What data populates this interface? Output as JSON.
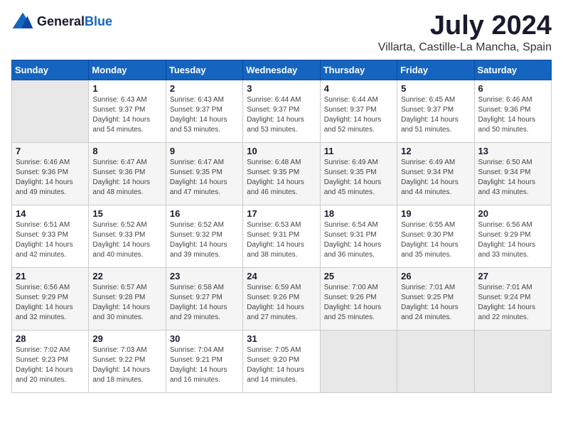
{
  "logo": {
    "general": "General",
    "blue": "Blue"
  },
  "title": "July 2024",
  "location": "Villarta, Castille-La Mancha, Spain",
  "header_days": [
    "Sunday",
    "Monday",
    "Tuesday",
    "Wednesday",
    "Thursday",
    "Friday",
    "Saturday"
  ],
  "weeks": [
    [
      {
        "num": "",
        "sunrise": "",
        "sunset": "",
        "daylight": ""
      },
      {
        "num": "1",
        "sunrise": "Sunrise: 6:43 AM",
        "sunset": "Sunset: 9:37 PM",
        "daylight": "Daylight: 14 hours and 54 minutes."
      },
      {
        "num": "2",
        "sunrise": "Sunrise: 6:43 AM",
        "sunset": "Sunset: 9:37 PM",
        "daylight": "Daylight: 14 hours and 53 minutes."
      },
      {
        "num": "3",
        "sunrise": "Sunrise: 6:44 AM",
        "sunset": "Sunset: 9:37 PM",
        "daylight": "Daylight: 14 hours and 53 minutes."
      },
      {
        "num": "4",
        "sunrise": "Sunrise: 6:44 AM",
        "sunset": "Sunset: 9:37 PM",
        "daylight": "Daylight: 14 hours and 52 minutes."
      },
      {
        "num": "5",
        "sunrise": "Sunrise: 6:45 AM",
        "sunset": "Sunset: 9:37 PM",
        "daylight": "Daylight: 14 hours and 51 minutes."
      },
      {
        "num": "6",
        "sunrise": "Sunrise: 6:46 AM",
        "sunset": "Sunset: 9:36 PM",
        "daylight": "Daylight: 14 hours and 50 minutes."
      }
    ],
    [
      {
        "num": "7",
        "sunrise": "Sunrise: 6:46 AM",
        "sunset": "Sunset: 9:36 PM",
        "daylight": "Daylight: 14 hours and 49 minutes."
      },
      {
        "num": "8",
        "sunrise": "Sunrise: 6:47 AM",
        "sunset": "Sunset: 9:36 PM",
        "daylight": "Daylight: 14 hours and 48 minutes."
      },
      {
        "num": "9",
        "sunrise": "Sunrise: 6:47 AM",
        "sunset": "Sunset: 9:35 PM",
        "daylight": "Daylight: 14 hours and 47 minutes."
      },
      {
        "num": "10",
        "sunrise": "Sunrise: 6:48 AM",
        "sunset": "Sunset: 9:35 PM",
        "daylight": "Daylight: 14 hours and 46 minutes."
      },
      {
        "num": "11",
        "sunrise": "Sunrise: 6:49 AM",
        "sunset": "Sunset: 9:35 PM",
        "daylight": "Daylight: 14 hours and 45 minutes."
      },
      {
        "num": "12",
        "sunrise": "Sunrise: 6:49 AM",
        "sunset": "Sunset: 9:34 PM",
        "daylight": "Daylight: 14 hours and 44 minutes."
      },
      {
        "num": "13",
        "sunrise": "Sunrise: 6:50 AM",
        "sunset": "Sunset: 9:34 PM",
        "daylight": "Daylight: 14 hours and 43 minutes."
      }
    ],
    [
      {
        "num": "14",
        "sunrise": "Sunrise: 6:51 AM",
        "sunset": "Sunset: 9:33 PM",
        "daylight": "Daylight: 14 hours and 42 minutes."
      },
      {
        "num": "15",
        "sunrise": "Sunrise: 6:52 AM",
        "sunset": "Sunset: 9:33 PM",
        "daylight": "Daylight: 14 hours and 40 minutes."
      },
      {
        "num": "16",
        "sunrise": "Sunrise: 6:52 AM",
        "sunset": "Sunset: 9:32 PM",
        "daylight": "Daylight: 14 hours and 39 minutes."
      },
      {
        "num": "17",
        "sunrise": "Sunrise: 6:53 AM",
        "sunset": "Sunset: 9:31 PM",
        "daylight": "Daylight: 14 hours and 38 minutes."
      },
      {
        "num": "18",
        "sunrise": "Sunrise: 6:54 AM",
        "sunset": "Sunset: 9:31 PM",
        "daylight": "Daylight: 14 hours and 36 minutes."
      },
      {
        "num": "19",
        "sunrise": "Sunrise: 6:55 AM",
        "sunset": "Sunset: 9:30 PM",
        "daylight": "Daylight: 14 hours and 35 minutes."
      },
      {
        "num": "20",
        "sunrise": "Sunrise: 6:56 AM",
        "sunset": "Sunset: 9:29 PM",
        "daylight": "Daylight: 14 hours and 33 minutes."
      }
    ],
    [
      {
        "num": "21",
        "sunrise": "Sunrise: 6:56 AM",
        "sunset": "Sunset: 9:29 PM",
        "daylight": "Daylight: 14 hours and 32 minutes."
      },
      {
        "num": "22",
        "sunrise": "Sunrise: 6:57 AM",
        "sunset": "Sunset: 9:28 PM",
        "daylight": "Daylight: 14 hours and 30 minutes."
      },
      {
        "num": "23",
        "sunrise": "Sunrise: 6:58 AM",
        "sunset": "Sunset: 9:27 PM",
        "daylight": "Daylight: 14 hours and 29 minutes."
      },
      {
        "num": "24",
        "sunrise": "Sunrise: 6:59 AM",
        "sunset": "Sunset: 9:26 PM",
        "daylight": "Daylight: 14 hours and 27 minutes."
      },
      {
        "num": "25",
        "sunrise": "Sunrise: 7:00 AM",
        "sunset": "Sunset: 9:26 PM",
        "daylight": "Daylight: 14 hours and 25 minutes."
      },
      {
        "num": "26",
        "sunrise": "Sunrise: 7:01 AM",
        "sunset": "Sunset: 9:25 PM",
        "daylight": "Daylight: 14 hours and 24 minutes."
      },
      {
        "num": "27",
        "sunrise": "Sunrise: 7:01 AM",
        "sunset": "Sunset: 9:24 PM",
        "daylight": "Daylight: 14 hours and 22 minutes."
      }
    ],
    [
      {
        "num": "28",
        "sunrise": "Sunrise: 7:02 AM",
        "sunset": "Sunset: 9:23 PM",
        "daylight": "Daylight: 14 hours and 20 minutes."
      },
      {
        "num": "29",
        "sunrise": "Sunrise: 7:03 AM",
        "sunset": "Sunset: 9:22 PM",
        "daylight": "Daylight: 14 hours and 18 minutes."
      },
      {
        "num": "30",
        "sunrise": "Sunrise: 7:04 AM",
        "sunset": "Sunset: 9:21 PM",
        "daylight": "Daylight: 14 hours and 16 minutes."
      },
      {
        "num": "31",
        "sunrise": "Sunrise: 7:05 AM",
        "sunset": "Sunset: 9:20 PM",
        "daylight": "Daylight: 14 hours and 14 minutes."
      },
      {
        "num": "",
        "sunrise": "",
        "sunset": "",
        "daylight": ""
      },
      {
        "num": "",
        "sunrise": "",
        "sunset": "",
        "daylight": ""
      },
      {
        "num": "",
        "sunrise": "",
        "sunset": "",
        "daylight": ""
      }
    ]
  ]
}
